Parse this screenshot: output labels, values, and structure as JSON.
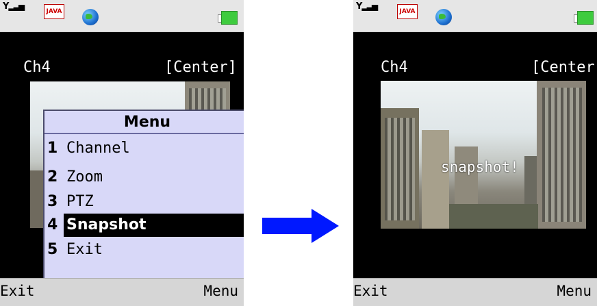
{
  "left_screen": {
    "status": {
      "signal": "Y",
      "java_label": "JAVA"
    },
    "channel": "Ch4",
    "position": "[Center]",
    "menu": {
      "title": "Menu",
      "items": [
        {
          "number": "1",
          "label": "Channel"
        },
        {
          "number": "2",
          "label": "Zoom"
        },
        {
          "number": "3",
          "label": "PTZ"
        },
        {
          "number": "4",
          "label": "Snapshot",
          "selected": true
        },
        {
          "number": "5",
          "label": "Exit"
        }
      ]
    },
    "softkeys": {
      "left": "Exit",
      "right": "Menu"
    }
  },
  "right_screen": {
    "status": {
      "signal": "Y",
      "java_label": "JAVA"
    },
    "channel": "Ch4",
    "position": "[Center]",
    "overlay_text": "snapshot!",
    "softkeys": {
      "left": "Exit",
      "right": "Menu"
    }
  },
  "icons": {
    "signal": "signal-icon",
    "java": "java-icon",
    "globe": "globe-icon",
    "battery": "battery-icon",
    "transition_arrow": "arrow-right-icon"
  },
  "colors": {
    "menu_bg": "#d8d8f8",
    "selection": "#000000",
    "arrow": "#0018ff",
    "battery": "#3ecb3e"
  }
}
